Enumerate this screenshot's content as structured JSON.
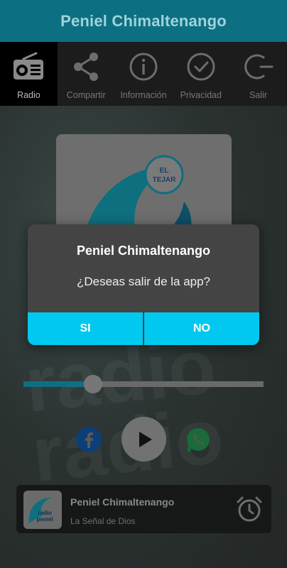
{
  "header": {
    "title": "Peniel Chimaltenango"
  },
  "tabs": [
    {
      "label": "Radio",
      "icon": "radio-icon",
      "active": true
    },
    {
      "label": "Compartir",
      "icon": "share-icon",
      "active": false
    },
    {
      "label": "Información",
      "icon": "info-icon",
      "active": false
    },
    {
      "label": "Privacidad",
      "icon": "check-circle-icon",
      "active": false
    },
    {
      "label": "Salir",
      "icon": "exit-icon",
      "active": false
    }
  ],
  "cover": {
    "badge_text": "EL TEJAR"
  },
  "player": {
    "progress": 0.26
  },
  "now_playing": {
    "title": "Peniel Chimaltenango",
    "subtitle": "La Señal de Dios",
    "logo_text": "radio peniel"
  },
  "dialog": {
    "title": "Peniel Chimaltenango",
    "message": "¿Deseas salir de la app?",
    "yes_label": "SI",
    "no_label": "NO"
  },
  "colors": {
    "header": "#0d7082",
    "accent": "#00c8ee",
    "dialog_bg": "#444444"
  }
}
